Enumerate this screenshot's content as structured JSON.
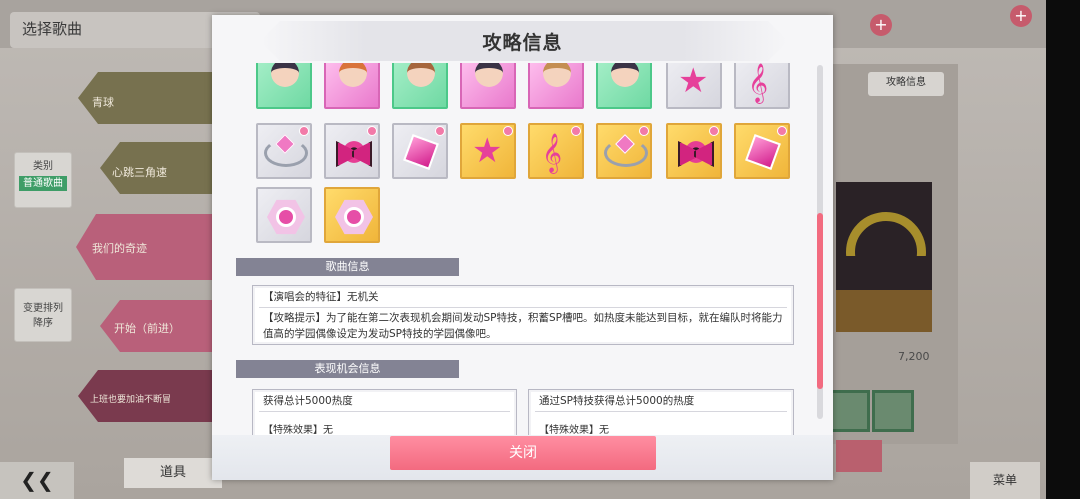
{
  "background": {
    "title": "选择歌曲",
    "songs": [
      {
        "label": "青球"
      },
      {
        "label": "心跳三角速"
      },
      {
        "label": "我们的奇迹"
      },
      {
        "label": "开始（前进）"
      },
      {
        "label": "上班也要加油不断冒"
      }
    ],
    "sort_button": {
      "label": "类别",
      "value": "普通歌曲"
    },
    "order_button": {
      "label": "变更排列",
      "sub": "降序"
    },
    "tool_button": "道具",
    "menu_button": "菜单",
    "back_button": "❮❮",
    "strategy_tag": "攻略信息",
    "score": "7,200"
  },
  "modal": {
    "title": "攻略信息",
    "sections": {
      "song_info": {
        "header": "歌曲信息",
        "feature": "【演唱会的特征】无机关",
        "tip_line1": "【攻略提示】为了能在第二次表现机会期间发动SP特技，积蓄SP槽吧。如热度未能达到目标，就在编队时将能力",
        "tip_line2": "值高的学园偶像设定为发动SP特技的学园偶像吧。"
      },
      "chance_info": {
        "header": "表现机会信息",
        "left_title": "获得总计5000热度",
        "left_effect": "【特殊效果】无",
        "right_title": "通过SP特技获得总计5000的热度",
        "right_effect": "【特殊效果】无"
      }
    },
    "close_label": "关闭"
  },
  "colors": {
    "accent_pink": "#f36a80",
    "section_header": "#838394",
    "scrollbar": "#f26b80"
  }
}
